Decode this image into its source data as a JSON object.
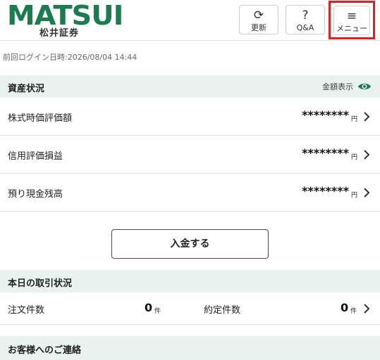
{
  "header": {
    "logo_main": "MATSUI",
    "logo_sub": "松井証券",
    "buttons": [
      {
        "label": "更新",
        "icon": "refresh-icon"
      },
      {
        "label": "Q&A",
        "icon": "question-icon"
      },
      {
        "label": "メニュー",
        "icon": "hamburger-icon"
      }
    ],
    "icon_glyphs": {
      "refresh": "⟳",
      "question": "?",
      "menu": "≡"
    }
  },
  "last_login": "前回ログイン日時:2026/08/04 14:44",
  "assets": {
    "title": "資産状況",
    "amount_toggle_label": "金額表示",
    "rows": [
      {
        "label": "株式時価評価額",
        "value": "********",
        "unit": "円"
      },
      {
        "label": "信用評価損益",
        "value": "********",
        "unit": "円"
      },
      {
        "label": "預り現金残高",
        "value": "********",
        "unit": "円"
      }
    ],
    "deposit_button": "入金する"
  },
  "trade": {
    "title": "本日の取引状況",
    "order_label": "注文件数",
    "order_count": "0",
    "order_unit": "件",
    "execution_label": "約定件数",
    "execution_count": "0",
    "execution_unit": "件"
  },
  "notice": {
    "title": "お客様へのご連絡"
  },
  "colors": {
    "brand": "#1a7d4f",
    "section_bg": "#e8f3ef",
    "highlight": "#e02020"
  }
}
